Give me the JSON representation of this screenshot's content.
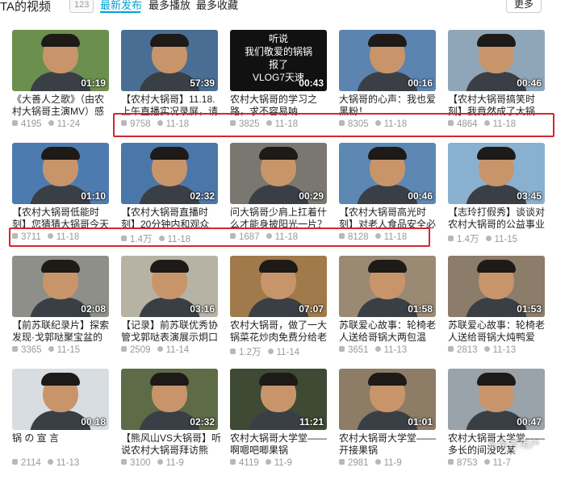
{
  "header": {
    "title": "TA的视频",
    "count": "123",
    "tabs": [
      "最新发布",
      "最多播放",
      "最多收藏"
    ],
    "more_label": "更多"
  },
  "videos": [
    {
      "title": "《大善人之歌》（由农村大锅哥主演MV）感",
      "views": "4195",
      "date": "11-24",
      "duration": "01:19",
      "thumb": "#6b8f4e"
    },
    {
      "title": "【农村大锅哥】11.18.上午直播实况录屏，请",
      "views": "9758",
      "date": "11-18",
      "duration": "57:39",
      "thumb": "#4a6e93"
    },
    {
      "title": "农村大锅哥的学习之路，求不容易呐",
      "views": "3825",
      "date": "11-18",
      "duration": "00:43",
      "thumb": "#111111",
      "overlay": [
        "听说",
        "我们敬爱的锅锅",
        "报了",
        "VLOG7天速"
      ]
    },
    {
      "title": "大锅哥的心声：我也爱黑粉！",
      "views": "8305",
      "date": "11-18",
      "duration": "00:16",
      "thumb": "#5b84b1"
    },
    {
      "title": "【农村大锅哥搞笑时刻】我竟然成了大锅",
      "views": "4864",
      "date": "11-18",
      "duration": "00:46",
      "thumb": "#8fa6b8"
    },
    {
      "title": "【农村大锅哥低能时刻】您猜猜大锅哥今天",
      "views": "3711",
      "date": "11-18",
      "duration": "01:10",
      "thumb": "#4d7bb0"
    },
    {
      "title": "【农村大锅哥直播时刻】20分钟内和观众",
      "views": "1.4万",
      "date": "11-18",
      "duration": "02:32",
      "thumb": "#4b77a8"
    },
    {
      "title": "问大锅哥少肩上扛着什么才能身披阳光一片？",
      "views": "1687",
      "date": "11-18",
      "duration": "00:29",
      "thumb": "#7a7670"
    },
    {
      "title": "【农村大锅哥高光时刻】对老人食品安全必",
      "views": "8128",
      "date": "11-18",
      "duration": "00:46",
      "thumb": "#5d88b4"
    },
    {
      "title": "【志玲打假秀】谈谈对农村大锅哥的公益事业",
      "views": "1.4万",
      "date": "11-15",
      "duration": "03:45",
      "thumb": "#8ab0cf"
    },
    {
      "title": "【前苏联纪录片】探索发现·戈郭哒聚宝盆的",
      "views": "3365",
      "date": "11-15",
      "duration": "02:08",
      "thumb": "#8e8f88"
    },
    {
      "title": "【记录】前苏联优秀协管戈郭哒表演展示炯口",
      "views": "2509",
      "date": "11-14",
      "duration": "03:16",
      "thumb": "#b7b3a4"
    },
    {
      "title": "农村大锅哥，做了一大锅菜花炒肉免费分给老",
      "views": "1.2万",
      "date": "11-14",
      "duration": "07:07",
      "thumb": "#a07a4a"
    },
    {
      "title": "苏联爱心故事：轮椅老人送给哥锅大两包温",
      "views": "3651",
      "date": "11-13",
      "duration": "01:58",
      "thumb": "#9a8a74"
    },
    {
      "title": "苏联爱心故事：轮椅老人送给哥锅大炖鸭爱",
      "views": "2813",
      "date": "11-13",
      "duration": "01:53",
      "thumb": "#8c7c6a"
    },
    {
      "title": "锅 の 宣 言",
      "views": "2114",
      "date": "11-13",
      "duration": "00:18",
      "thumb": "#d8dde2"
    },
    {
      "title": "【熊风山VS大锅哥】听说农村大锅哥拜访熊",
      "views": "3100",
      "date": "11-9",
      "duration": "02:32",
      "thumb": "#5d6b47"
    },
    {
      "title": "农村大锅哥大学堂——啊嗯吧唧果锅",
      "views": "4119",
      "date": "11-9",
      "duration": "11:21",
      "thumb": "#3e4a33"
    },
    {
      "title": "农村大锅哥大学堂——开接果锅",
      "views": "2981",
      "date": "11-9",
      "duration": "01:01",
      "thumb": "#8d7c66"
    },
    {
      "title": "农村大锅哥大学堂——多长的间没吃某",
      "views": "8753",
      "date": "11-7",
      "duration": "00:47",
      "thumb": "#9aa3aa"
    }
  ],
  "watermark": "头条号用户"
}
